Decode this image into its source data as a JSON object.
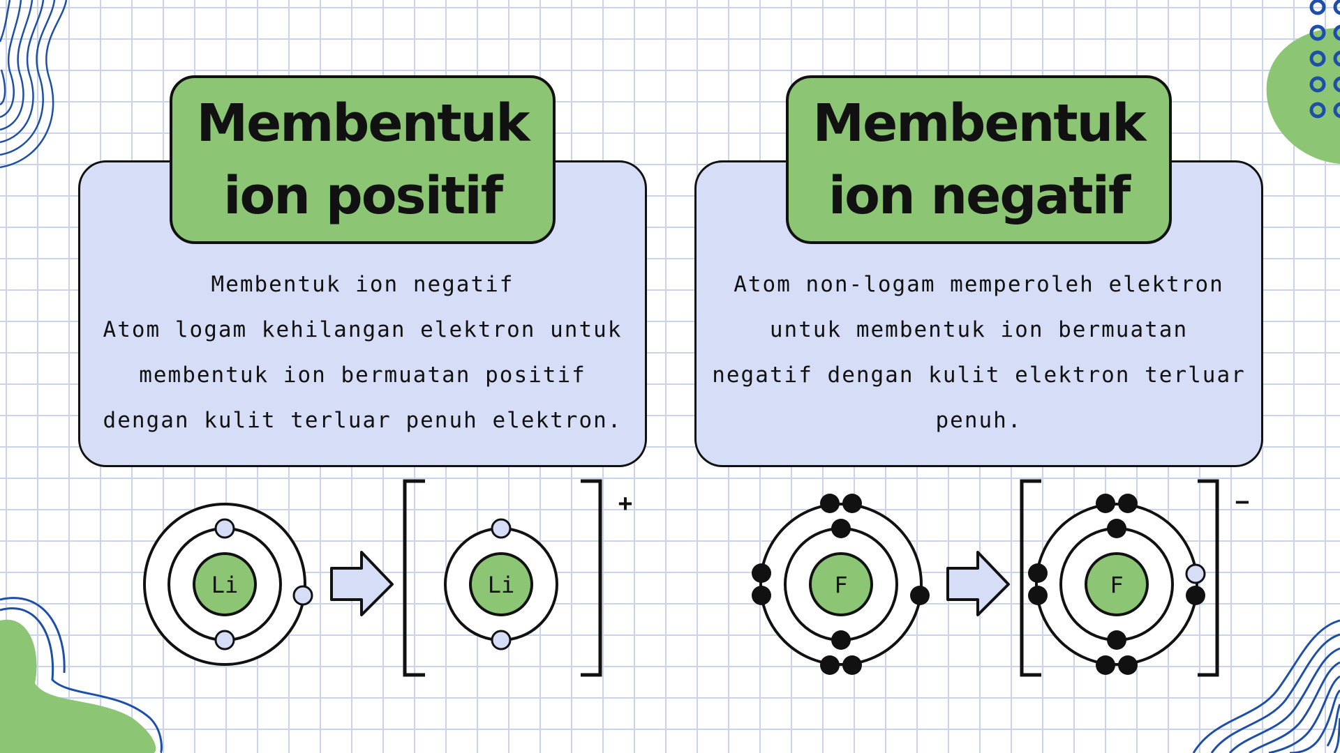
{
  "left_card": {
    "title_line1": "Membentuk",
    "title_line2": "ion positif",
    "body_lines": [
      "Membentuk ion negatif",
      "Atom logam kehilangan elektron untuk",
      "membentuk ion bermuatan positif",
      "dengan kulit terluar penuh elektron."
    ],
    "atom_symbol": "Li",
    "ion_symbol": "Li",
    "ion_charge": "+"
  },
  "right_card": {
    "title_line1": "Membentuk",
    "title_line2": "ion negatif",
    "body_lines": [
      "Atom non-logam memperoleh elektron",
      "untuk membentuk ion bermuatan",
      "negatif dengan kulit elektron terluar",
      "penuh."
    ],
    "atom_symbol": "F",
    "ion_symbol": "F",
    "ion_charge": "−"
  },
  "colors": {
    "green": "#8cc574",
    "card": "#d6ddf6",
    "blue_deco": "#1d4fa8",
    "electron_hollow": "#d6ddf6",
    "electron_solid": "#111111"
  }
}
